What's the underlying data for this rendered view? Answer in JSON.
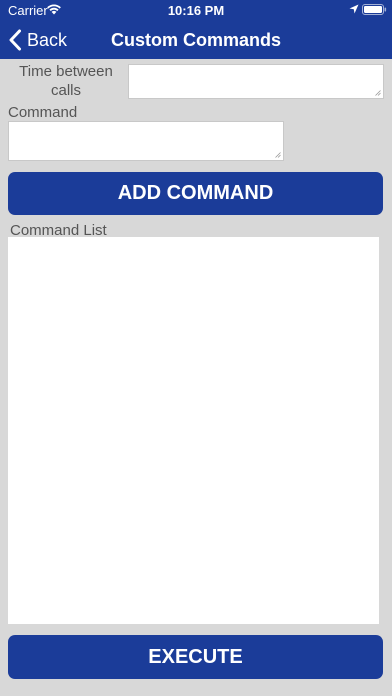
{
  "status_bar": {
    "carrier": "Carrier",
    "time": "10:16 PM",
    "icons": [
      "wifi-icon",
      "location-icon",
      "battery-icon"
    ]
  },
  "nav": {
    "back_label": "Back",
    "title": "Custom Commands"
  },
  "form": {
    "time_between_calls_label": "Time between calls",
    "time_between_calls_value": "",
    "command_label": "Command",
    "command_value": "",
    "add_button_label": "ADD COMMAND",
    "command_list_label": "Command List",
    "command_list_items": [],
    "execute_button_label": "EXECUTE"
  },
  "colors": {
    "brand": "#1b3c99",
    "background": "#d8d8d8",
    "label_text": "#555555"
  }
}
